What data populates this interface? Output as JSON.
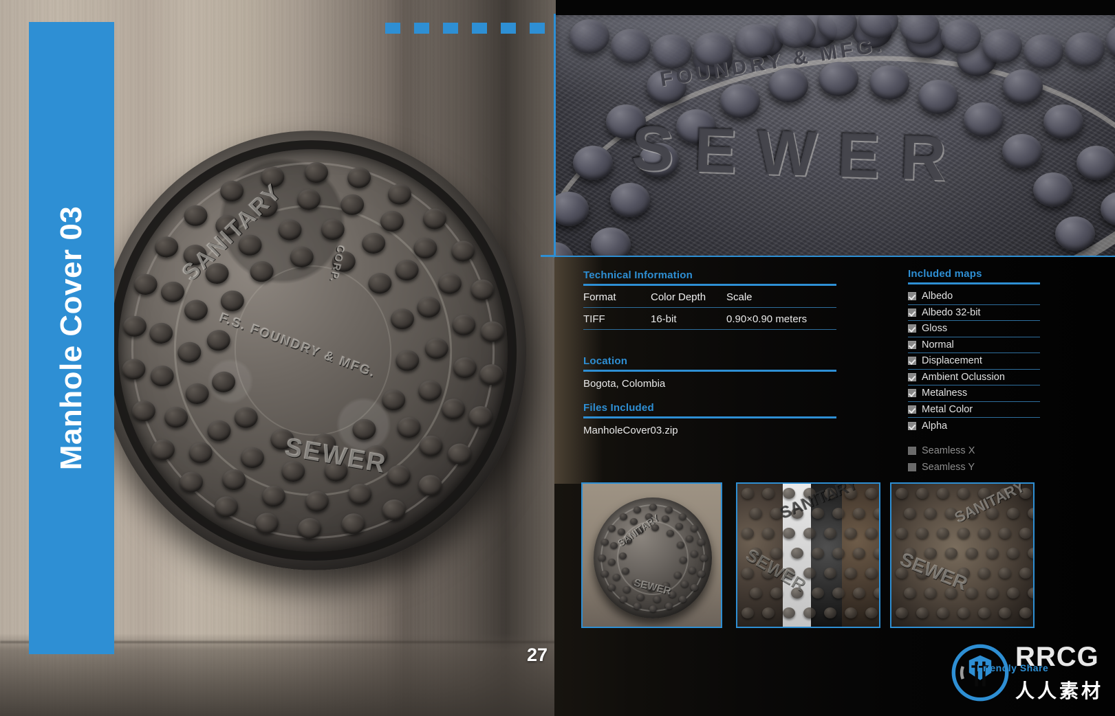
{
  "sidebar": {
    "title": "Manhole Cover 03",
    "accent_color": "#2e8fd4"
  },
  "page": {
    "number": "27"
  },
  "technical_information": {
    "heading": "Technical Information",
    "columns": [
      "Format",
      "Color Depth",
      "Scale"
    ],
    "rows": [
      [
        "TIFF",
        "16-bit",
        "0.90×0.90 meters"
      ]
    ]
  },
  "location": {
    "heading": "Location",
    "value": "Bogota, Colombia"
  },
  "files_included": {
    "heading": "Files Included",
    "value": "ManholeCover03.zip"
  },
  "included_maps": {
    "heading": "Included maps",
    "items": [
      {
        "label": "Albedo",
        "checked": true
      },
      {
        "label": "Albedo 32-bit",
        "checked": true
      },
      {
        "label": "Gloss",
        "checked": true
      },
      {
        "label": "Normal",
        "checked": true
      },
      {
        "label": "Displacement",
        "checked": true
      },
      {
        "label": "Ambient Oclussion",
        "checked": true
      },
      {
        "label": "Metalness",
        "checked": true
      },
      {
        "label": "Metal Color",
        "checked": true
      },
      {
        "label": "Alpha",
        "checked": true
      }
    ],
    "seamless": [
      {
        "label": "Seamless X",
        "checked": false
      },
      {
        "label": "Seamless Y",
        "checked": false
      }
    ]
  },
  "hero_image": {
    "embossed_text": [
      "SANITARY",
      "SEWER",
      "F.S. FOUNDRY & MFG.",
      "CORP."
    ]
  },
  "detail_image": {
    "embossed_text": [
      "SEWER",
      "FOUNDRY & MFG."
    ]
  },
  "thumbnails": [
    {
      "caption": ""
    },
    {
      "caption": ""
    },
    {
      "caption": ""
    }
  ],
  "watermark": {
    "brand": "RRCG",
    "tagline": "Friendly Share",
    "chinese": "人人素材"
  },
  "decor": {
    "dash_count": 6,
    "dash_color": "#2e8fd4"
  }
}
